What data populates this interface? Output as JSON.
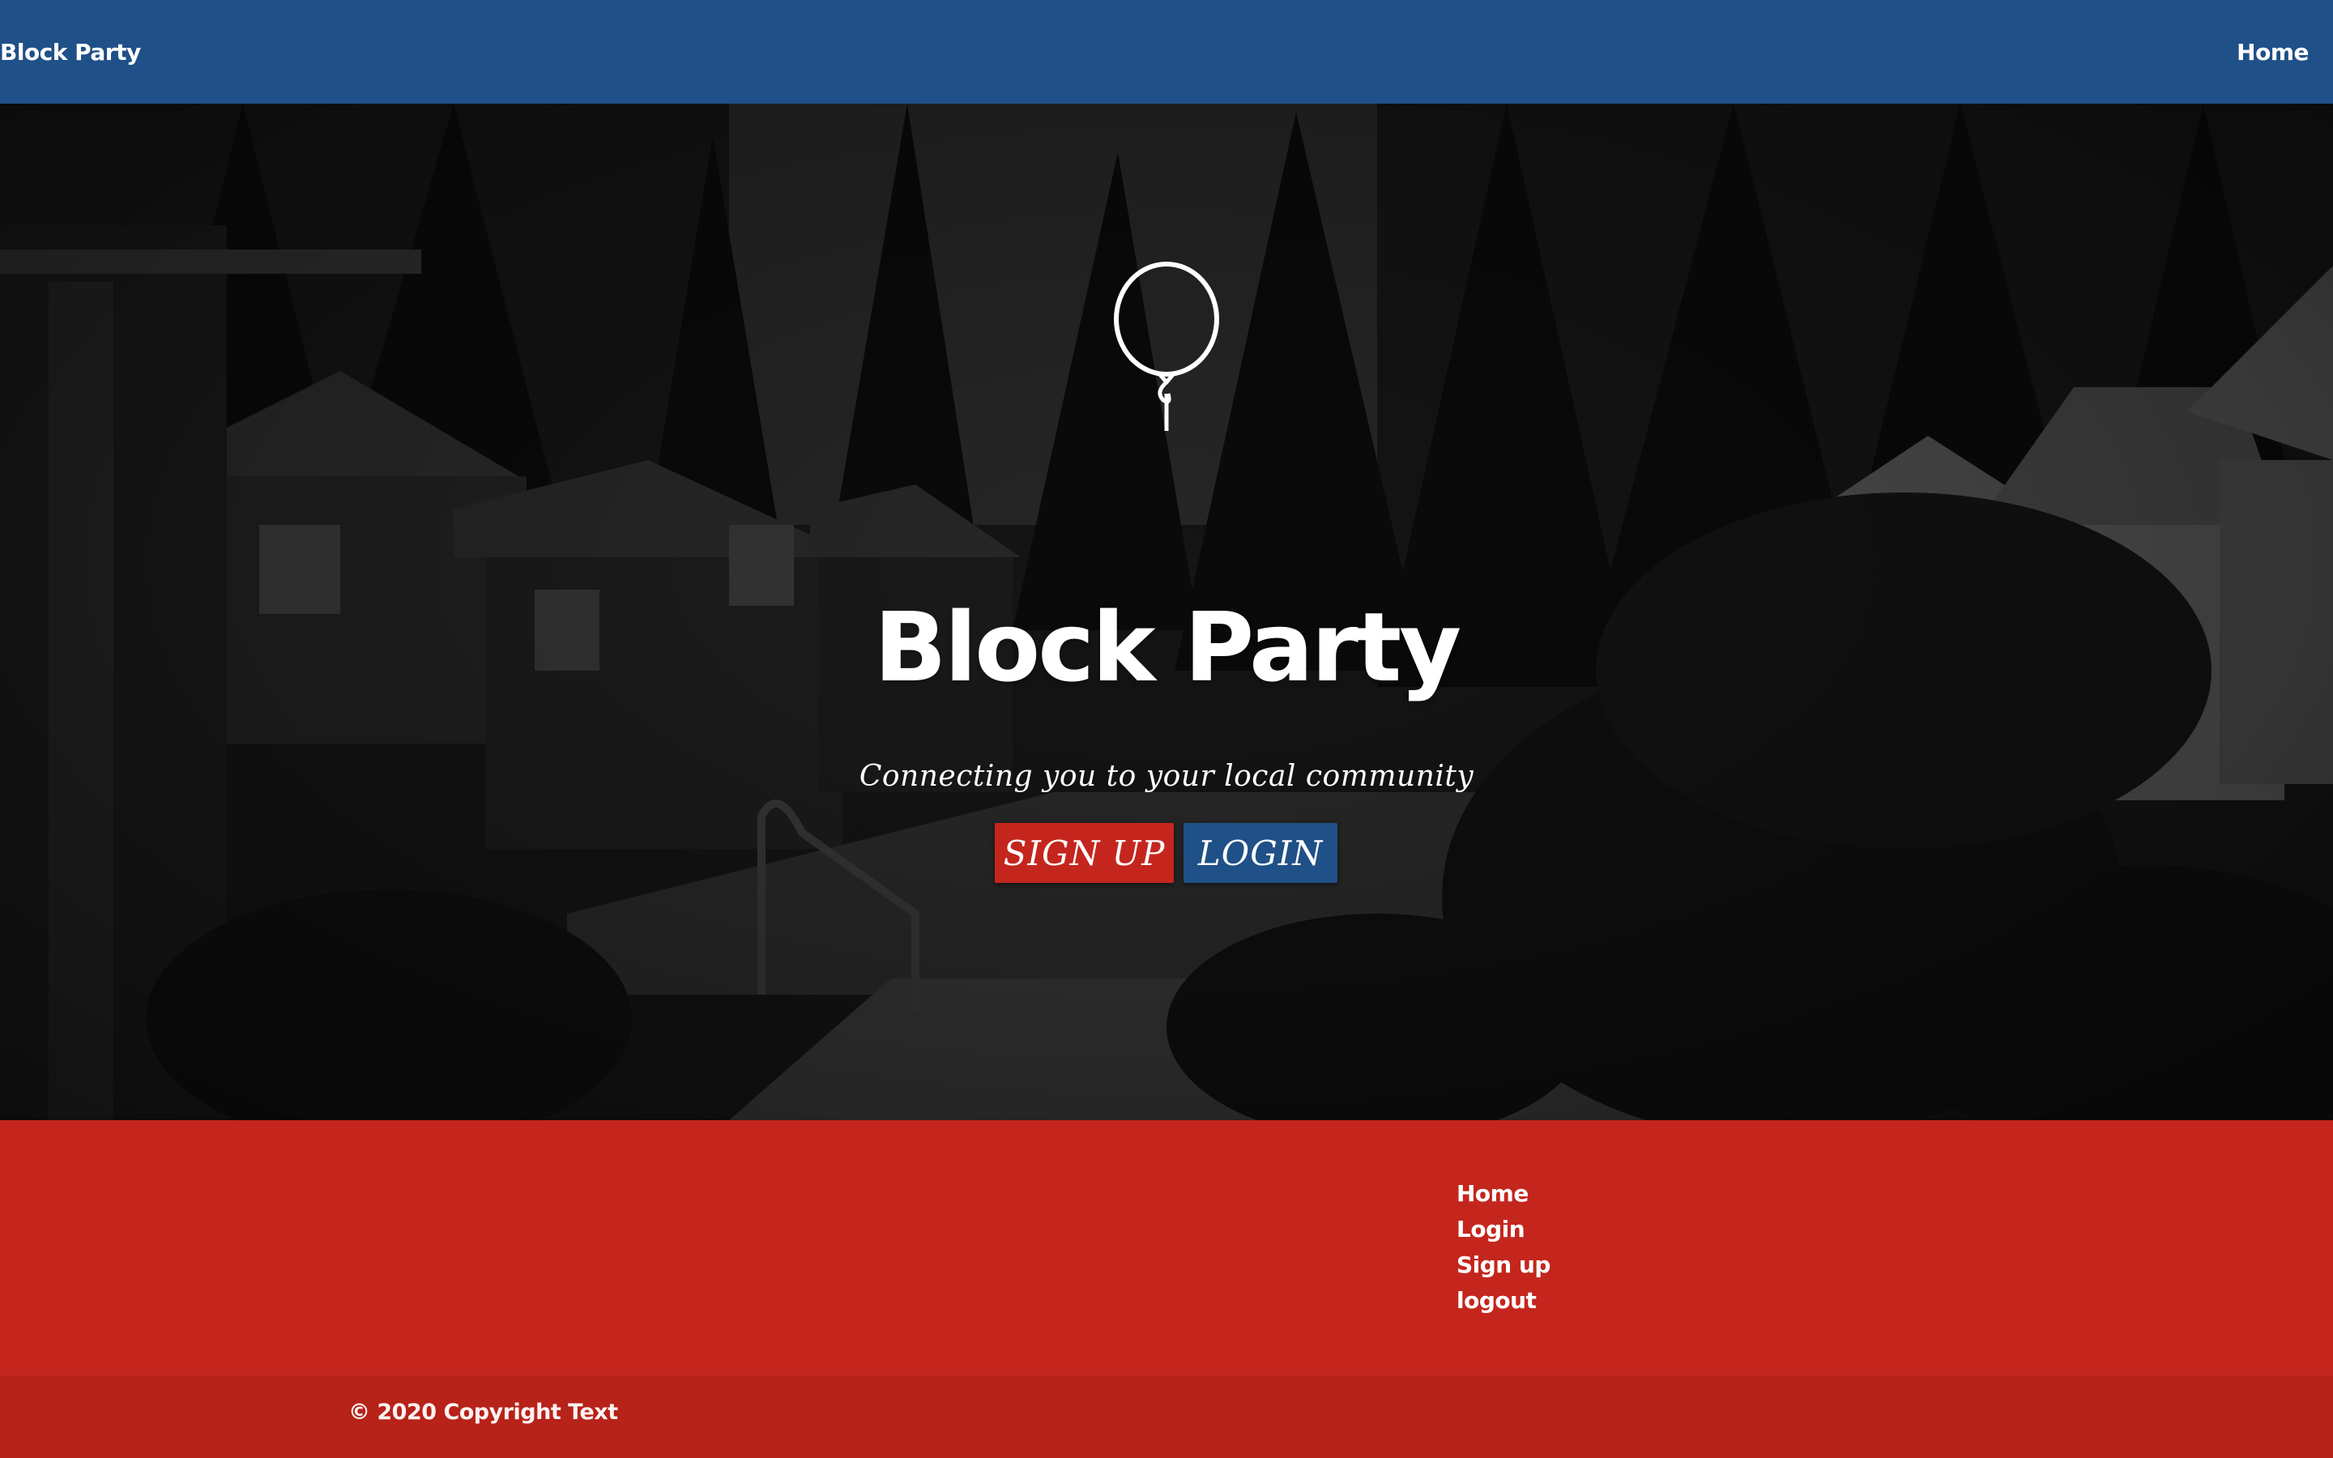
{
  "navbar": {
    "brand": "Block Party",
    "home_label": "Home"
  },
  "hero": {
    "icon": "balloon-icon",
    "title": "Block Party",
    "subtitle": "Connecting you to your local community",
    "signup_label": "SIGN UP",
    "login_label": "LOGIN"
  },
  "footer": {
    "links": [
      {
        "label": "Home"
      },
      {
        "label": "Login"
      },
      {
        "label": "Sign up"
      },
      {
        "label": "logout"
      }
    ],
    "copyright": "© 2020 Copyright Text"
  },
  "colors": {
    "navbar": "#1f5087",
    "footer": "#c4261d",
    "copyright_bar": "#b72219",
    "signup_button": "#c4261d",
    "login_button": "#1f5087"
  }
}
